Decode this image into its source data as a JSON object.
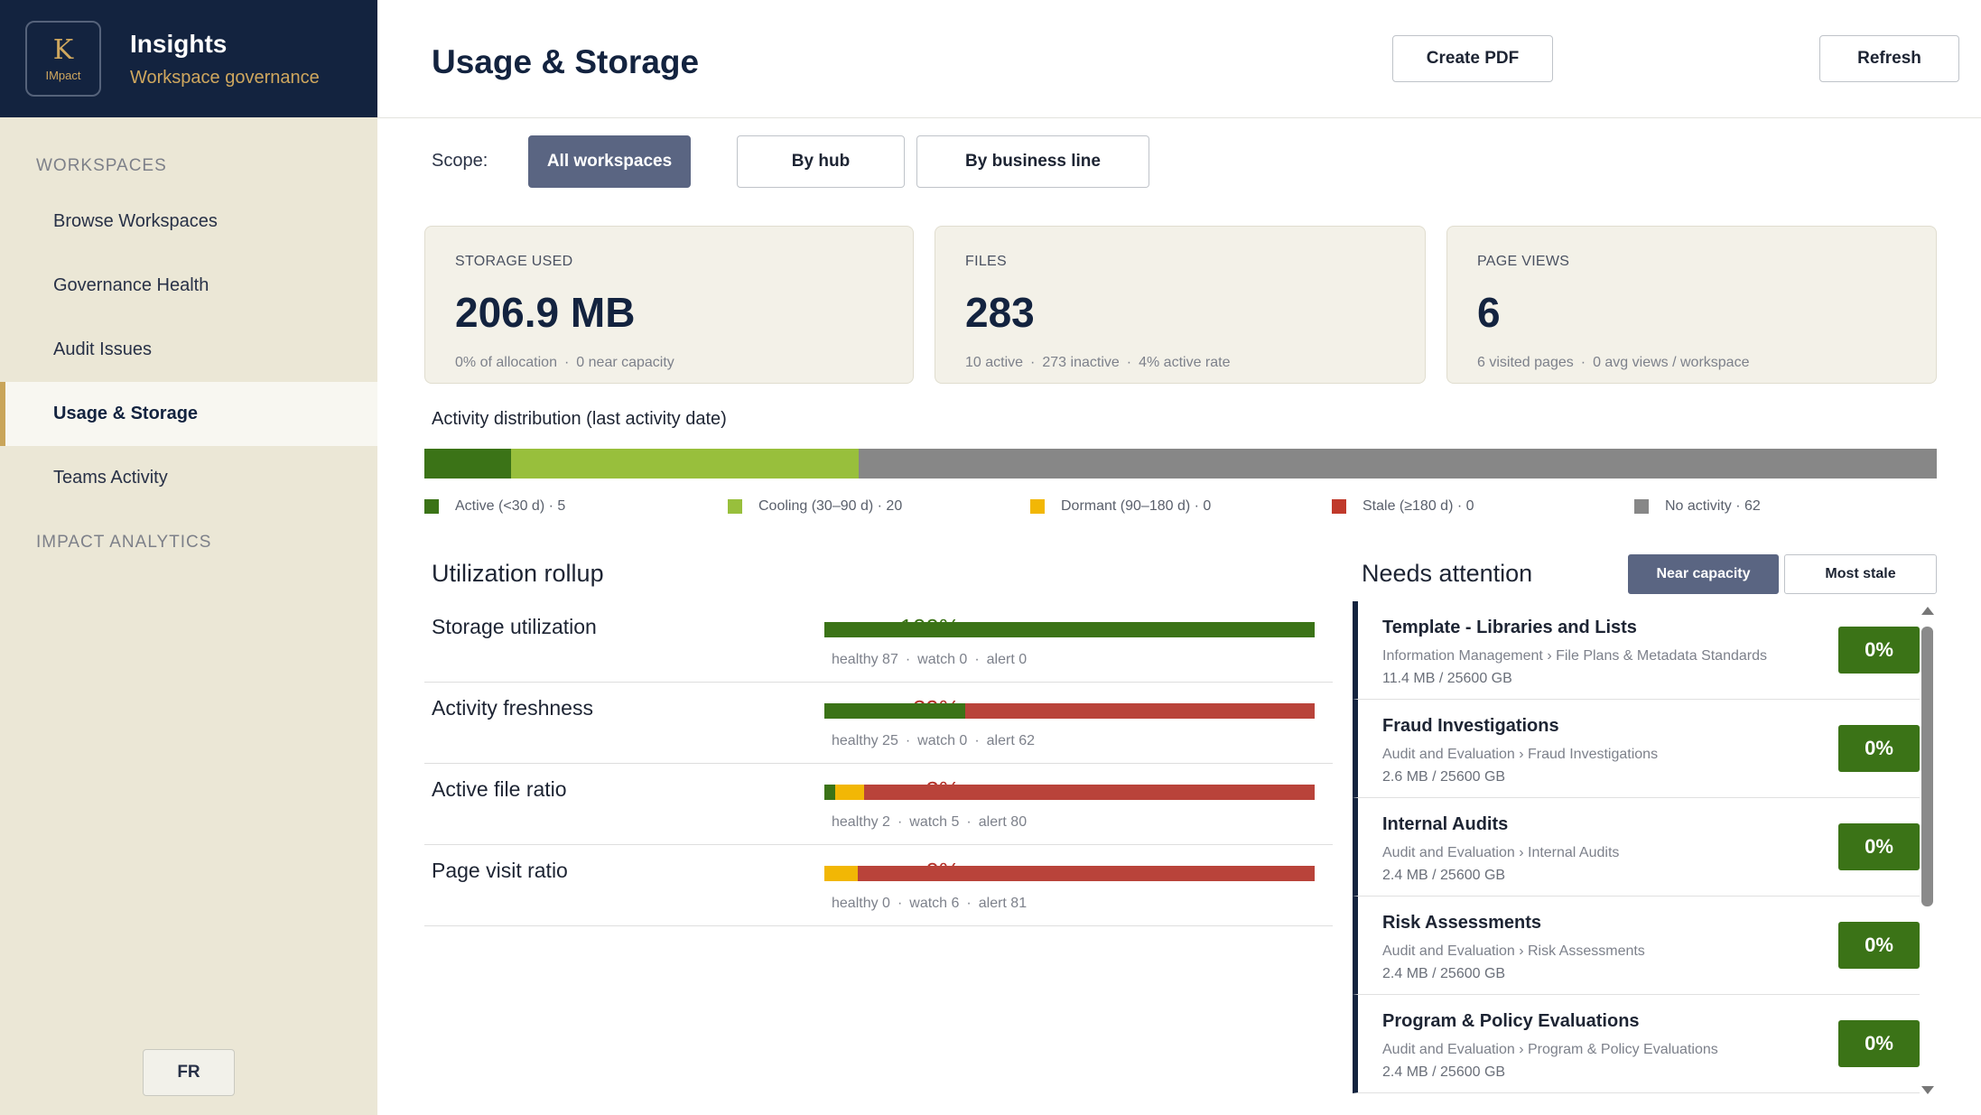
{
  "brand": {
    "logo_letter": "K",
    "logo_sub": "IMpact",
    "title": "Insights",
    "subtitle": "Workspace governance"
  },
  "sidebar": {
    "section_workspaces": "WORKSPACES",
    "items": [
      {
        "label": "Browse Workspaces"
      },
      {
        "label": "Governance Health"
      },
      {
        "label": "Audit Issues"
      },
      {
        "label": "Usage & Storage"
      },
      {
        "label": "Teams Activity"
      }
    ],
    "section_impact": "IMPACT ANALYTICS",
    "lang_button": "FR"
  },
  "header": {
    "title": "Usage & Storage",
    "create_pdf": "Create PDF",
    "refresh": "Refresh"
  },
  "scope": {
    "label": "Scope:",
    "options": [
      "All workspaces",
      "By hub",
      "By business line"
    ],
    "selected": "All workspaces"
  },
  "kpis": [
    {
      "label": "STORAGE USED",
      "value": "206.9 MB",
      "sub1": "0% of allocation",
      "sub2": "0 near capacity",
      "sub3": ""
    },
    {
      "label": "FILES",
      "value": "283",
      "sub1": "10 active",
      "sub2": "273 inactive",
      "sub3": "4% active rate"
    },
    {
      "label": "PAGE VIEWS",
      "value": "6",
      "sub1": "6 visited pages",
      "sub2": "0 avg views / workspace",
      "sub3": ""
    }
  ],
  "separator": "·",
  "distribution": {
    "title": "Activity distribution (last activity date)",
    "segments": [
      {
        "label": "Active (<30 d) · 5",
        "count": 5,
        "color": "#3b7317"
      },
      {
        "label": "Cooling (30–90 d) · 20",
        "count": 20,
        "color": "#98bf3c"
      },
      {
        "label": "Dormant (90–180 d) · 0",
        "count": 0,
        "color": "#f2b705"
      },
      {
        "label": "Stale (≥180 d) · 0",
        "count": 0,
        "color": "#c0392b"
      },
      {
        "label": "No activity · 62",
        "count": 62,
        "color": "#878787"
      }
    ]
  },
  "utilization": {
    "title": "Utilization rollup",
    "rows": [
      {
        "name": "Storage utilization",
        "pct": "100%",
        "pct_color": "#3b7317",
        "healthy": 87,
        "watch": 0,
        "alert": 0,
        "healthy_label": "healthy 87",
        "watch_label": "watch 0",
        "alert_label": "alert 0"
      },
      {
        "name": "Activity freshness",
        "pct": "29%",
        "pct_color": "#b5322a",
        "healthy": 25,
        "watch": 0,
        "alert": 62,
        "healthy_label": "healthy 25",
        "watch_label": "watch 0",
        "alert_label": "alert 62"
      },
      {
        "name": "Active file ratio",
        "pct": "2%",
        "pct_color": "#b5322a",
        "healthy": 2,
        "watch": 5,
        "alert": 80,
        "healthy_label": "healthy 2",
        "watch_label": "watch 5",
        "alert_label": "alert 80"
      },
      {
        "name": "Page visit ratio",
        "pct": "0%",
        "pct_color": "#b5322a",
        "healthy": 0,
        "watch": 6,
        "alert": 81,
        "healthy_label": "healthy 0",
        "watch_label": "watch 6",
        "alert_label": "alert 81"
      }
    ],
    "colors": {
      "healthy": "#3b7317",
      "watch": "#f2b705",
      "alert": "#b9433a"
    }
  },
  "needs_attention": {
    "title": "Needs attention",
    "tabs": [
      "Near capacity",
      "Most stale"
    ],
    "selected_tab": "Near capacity",
    "items": [
      {
        "name": "Template - Libraries and Lists",
        "path": "Information Management › File Plans & Metadata Standards",
        "size": "11.4 MB / 25600 GB",
        "pct": "0%"
      },
      {
        "name": "Fraud Investigations",
        "path": "Audit and Evaluation › Fraud Investigations",
        "size": "2.6 MB / 25600 GB",
        "pct": "0%"
      },
      {
        "name": "Internal Audits",
        "path": "Audit and Evaluation › Internal Audits",
        "size": "2.4 MB / 25600 GB",
        "pct": "0%"
      },
      {
        "name": "Risk Assessments",
        "path": "Audit and Evaluation › Risk Assessments",
        "size": "2.4 MB / 25600 GB",
        "pct": "0%"
      },
      {
        "name": "Program & Policy Evaluations",
        "path": "Audit and Evaluation › Program & Policy Evaluations",
        "size": "2.4 MB / 25600 GB",
        "pct": "0%"
      }
    ]
  }
}
